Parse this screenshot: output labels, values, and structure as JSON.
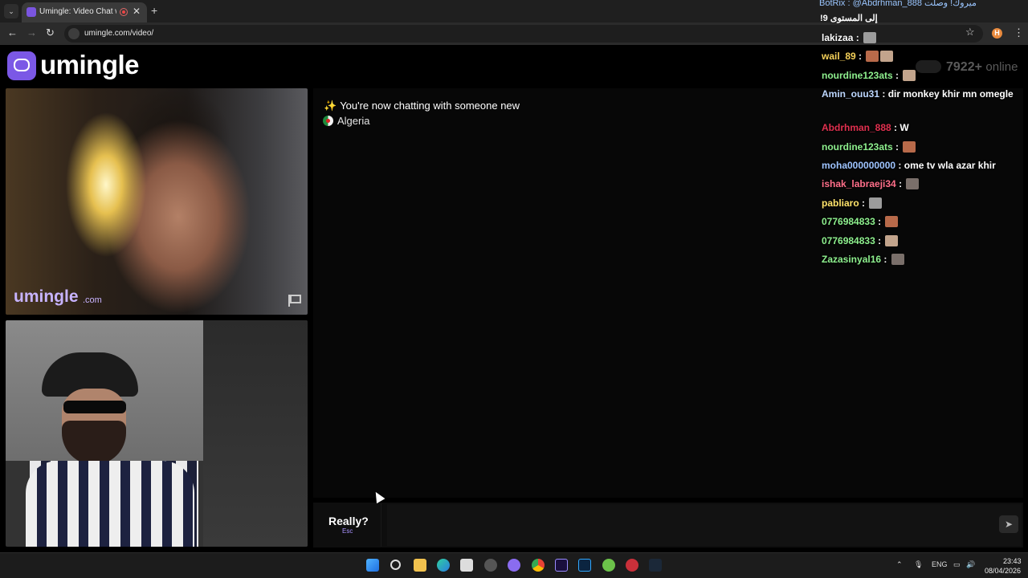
{
  "browser": {
    "tab_title": "Umingle: Video Chat with St",
    "tab_close": "✕",
    "new_tab": "+",
    "url": "umingle.com/video/"
  },
  "brand": {
    "logo_text": "umingle",
    "watermark": "umingle",
    "watermark_suffix": ".com",
    "accent_color": "#7b58e6"
  },
  "stats": {
    "online_count": "7922+",
    "online_label": "online"
  },
  "chat": {
    "system_message": "You're now chatting with someone new",
    "country": "Algeria",
    "stop_label": "Really?",
    "stop_key": "Esc",
    "input_value": "",
    "input_placeholder": ""
  },
  "stream_overlay": {
    "top_line": "BotRix : @Abdrhman_888 ميروك! وصلت",
    "top_line2": "!إلى المستوى 9",
    "messages": [
      {
        "user": "lakizaa",
        "color": "#ffffff",
        "text": "",
        "emotes": 1
      },
      {
        "user": "wail_89",
        "color": "#f5d15a",
        "text": "",
        "emotes": 2
      },
      {
        "user": "nourdine123ats",
        "color": "#8ef08e",
        "text": "",
        "emotes": 1
      },
      {
        "user": "Amin_ouu31",
        "color": "#bdd7ff",
        "text": "dir monkey khir mn omegle",
        "emotes": 0
      },
      {
        "user": "Abdrhman_888",
        "color": "#e0304f",
        "text": "W",
        "emotes": 0
      },
      {
        "user": "nourdine123ats",
        "color": "#8ef08e",
        "text": "",
        "emotes": 1
      },
      {
        "user": "moha000000000",
        "color": "#9ec4ff",
        "text": "ome tv wla azar khir",
        "emotes": 0
      },
      {
        "user": "ishak_labraeji34",
        "color": "#ff6f8a",
        "text": "",
        "emotes": 1
      },
      {
        "user": "pabliaro",
        "color": "#ffe36b",
        "text": "",
        "emotes": 1
      },
      {
        "user": "0776984833",
        "color": "#8ef08e",
        "text": "",
        "emotes": 1
      },
      {
        "user": "0776984833",
        "color": "#8ef08e",
        "text": "",
        "emotes": 1
      },
      {
        "user": "Zazasinyal16",
        "color": "#8ef08e",
        "text": "",
        "emotes": 1
      }
    ]
  },
  "taskbar": {
    "language": "ENG",
    "time": "23:43",
    "date": "08/04/2026"
  }
}
